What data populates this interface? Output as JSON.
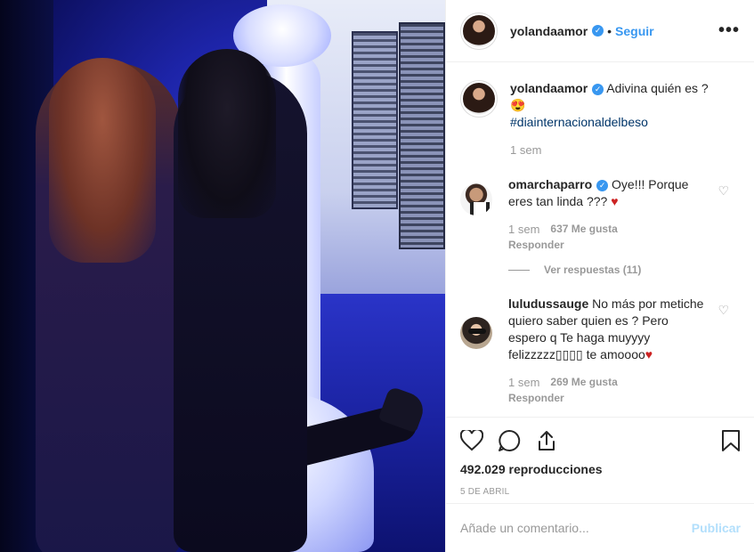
{
  "header": {
    "username": "yolandaamor",
    "separator": "•",
    "follow_label": "Seguir",
    "more_label": "•••"
  },
  "caption": {
    "username": "yolandaamor",
    "text": "Adivina quién es ? 😍",
    "hashtag": "#diainternacionaldelbeso",
    "time": "1 sem"
  },
  "comments": [
    {
      "username": "omarchaparro",
      "verified": true,
      "text": "Oye!!! Porque eres tan linda ???",
      "heart": "♥",
      "time": "1 sem",
      "likes": "637 Me gusta",
      "reply_label": "Responder"
    },
    {
      "username": "luludussauge",
      "verified": false,
      "text": "No más por metiche quiero saber quien es ? Pero espero q Te haga muyyyy felizzzzz▯▯▯▯ te amoooo",
      "heart": "♥",
      "time": "1 sem",
      "likes": "269 Me gusta",
      "reply_label": "Responder"
    }
  ],
  "view_replies_label": "Ver respuestas (11)",
  "stats": {
    "views": "492.029 reproducciones",
    "date": "5 DE ABRIL"
  },
  "composer": {
    "placeholder": "Añade un comentario...",
    "publish_label": "Publicar"
  },
  "icons": {
    "verified": "✓",
    "like_small": "♡"
  },
  "colors": {
    "link_blue": "#3897f0",
    "verified_blue": "#3897f0",
    "publish_disabled": "#b2dffc",
    "heart_red": "#cc2222"
  }
}
